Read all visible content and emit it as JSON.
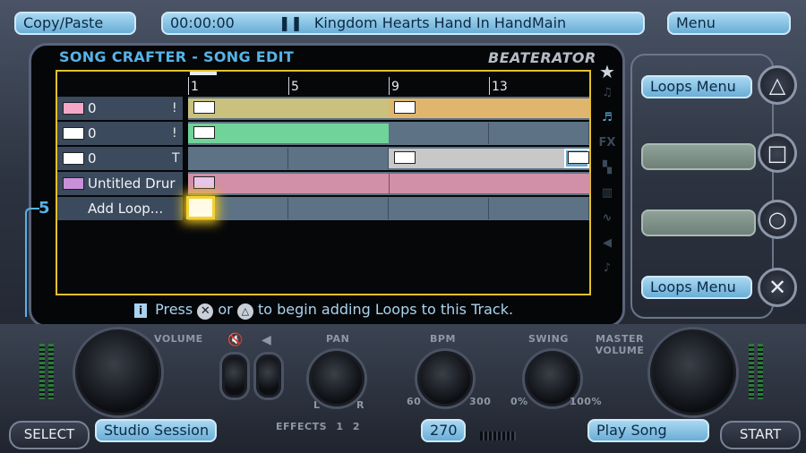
{
  "topbar": {
    "copy_paste": "Copy/Paste",
    "time": "00:00:00",
    "song_title": "Kingdom Hearts Hand In HandMain",
    "menu": "Menu"
  },
  "screen": {
    "title": "SONG CRAFTER - SONG EDIT",
    "brand": "BEATERATOR"
  },
  "ruler": {
    "ticks": [
      "1",
      "5",
      "9",
      "13"
    ]
  },
  "tracks": [
    {
      "name": "0",
      "tail": "!",
      "type": "melody"
    },
    {
      "name": "0",
      "tail": "!",
      "type": "melody"
    },
    {
      "name": "0",
      "tail": "T",
      "type": "melody"
    },
    {
      "name": "Untitled Drur",
      "tail": "",
      "type": "drum"
    }
  ],
  "add_loop": "Add Loop...",
  "track_counter": "5",
  "hint": {
    "pre": "Press",
    "or": "or",
    "post": "to begin adding Loops to this Track."
  },
  "right_panel": {
    "loops_menu_top": "Loops Menu",
    "loops_menu_bottom": "Loops Menu"
  },
  "controls": {
    "volume": "VOLUME",
    "pan": "PAN",
    "bpm": "BPM",
    "swing": "SWING",
    "master_volume": "MASTER VOLUME",
    "effects": "EFFECTS",
    "effects_1": "1",
    "effects_2": "2",
    "pan_l": "L",
    "pan_r": "R",
    "bpm_min": "60",
    "bpm_max": "300",
    "swing_min": "0%",
    "swing_max": "100%"
  },
  "bottom": {
    "select": "SELECT",
    "studio_session": "Studio Session",
    "bpm_value": "270",
    "play_song": "Play Song",
    "start": "START"
  }
}
